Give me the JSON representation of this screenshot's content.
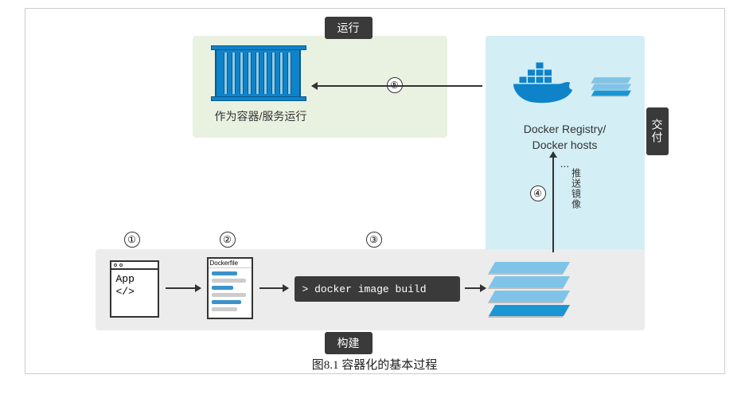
{
  "caption": "图8.1  容器化的基本过程",
  "labels": {
    "run": "运行",
    "build": "构建",
    "deliver": "交付",
    "push_image": "推送镜像"
  },
  "top": {
    "container_as_service": "作为容器/服务运行"
  },
  "registry": {
    "line1": "Docker Registry/",
    "line2": "Docker hosts",
    "dots": "..."
  },
  "build_row": {
    "app_name": "App",
    "app_code": "</>",
    "dockerfile_title": "Dockerfile",
    "cmd": "> docker image build"
  },
  "steps": {
    "s1": "①",
    "s2": "②",
    "s3": "③",
    "s4": "④",
    "s5": "⑤"
  }
}
